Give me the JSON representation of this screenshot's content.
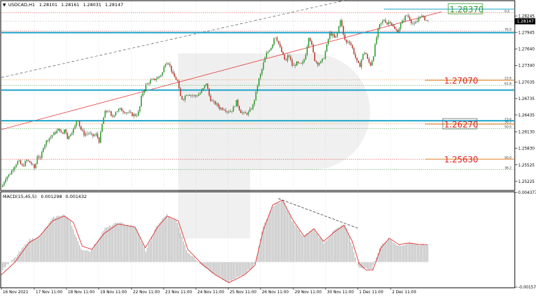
{
  "chart_data": [
    {
      "type": "candlestick",
      "header": {
        "symbol": "USDCAD,H1",
        "open": "1.28101",
        "high": "1.28161",
        "low": "1.28031",
        "close": "1.28147"
      },
      "current_price_label": "1.28147",
      "y_ticks": [
        "1.28245",
        "1.27945",
        "1.27640",
        "1.27340",
        "1.27035",
        "1.26735",
        "1.26435",
        "1.26130",
        "1.25830",
        "1.25525",
        "1.25225"
      ],
      "ylim": [
        1.2507,
        1.2851
      ],
      "x_ticks": [
        "16 Nov 2021",
        "17 Nov 11:00",
        "18 Nov 11:00",
        "19 Nov 11:00",
        "22 Nov 11:00",
        "23 Nov 11:00",
        "24 Nov 11:00",
        "25 Nov 11:00",
        "26 Nov 11:00",
        "29 Nov 11:00",
        "30 Nov 11:00",
        "1 Dec 11:00",
        "2 Dec 11:00"
      ],
      "horizontal_levels": [
        {
          "label": "1.28370",
          "value": 1.2837,
          "color": "#2e9e2e",
          "boxed": true
        },
        {
          "label": "1.27070",
          "value": 1.2707,
          "color": "#e02020",
          "boxed": false
        },
        {
          "label": "1.26270",
          "value": 1.2627,
          "color": "#e02020",
          "boxed": true
        },
        {
          "label": "1.25630",
          "value": 1.2563,
          "color": "#e02020",
          "boxed": false
        }
      ],
      "support_lines": [
        {
          "value": 1.2794,
          "color": "#17a2c8"
        },
        {
          "value": 1.2689,
          "color": "#17a2c8"
        },
        {
          "value": 1.2633,
          "color": "#17a2c8"
        }
      ],
      "fibo_upper": [
        {
          "label": "0.0",
          "value": 1.283,
          "color": "#e02020"
        },
        {
          "label": "76.0",
          "value": 1.2797,
          "color": "#e02020"
        },
        {
          "label": "23.6",
          "value": 1.2708,
          "color": "#e08020"
        },
        {
          "label": "61.8",
          "value": 1.2698,
          "color": "#2e9e2e"
        },
        {
          "label": "23.6",
          "value": 1.2633,
          "color": "#2e9e2e"
        },
        {
          "label": "38.2",
          "value": 1.2628,
          "color": "#e08020"
        },
        {
          "label": "50.0",
          "value": 1.2619,
          "color": "#2e9e2e"
        }
      ],
      "fibo_lower": [
        {
          "label": "50.0",
          "value": 1.2563,
          "color": "#e02020"
        },
        {
          "label": "38.2",
          "value": 1.2544,
          "color": "#2e9e2e"
        }
      ],
      "trend_lines": [
        {
          "from": [
            0,
            1.2712
          ],
          "to": [
            548,
            1.2866
          ],
          "color": "#555555",
          "dash": true
        },
        {
          "from": [
            0,
            1.2617
          ],
          "to": [
            642,
            1.2832
          ],
          "color": "#e02020",
          "dash": false
        }
      ],
      "close_path": [
        [
          0,
          1.2512
        ],
        [
          5,
          1.2528
        ],
        [
          12,
          1.2537
        ],
        [
          18,
          1.255
        ],
        [
          24,
          1.256
        ],
        [
          30,
          1.2549
        ],
        [
          36,
          1.2561
        ],
        [
          42,
          1.2556
        ],
        [
          48,
          1.2545
        ],
        [
          52,
          1.2572
        ],
        [
          56,
          1.2562
        ],
        [
          60,
          1.2585
        ],
        [
          66,
          1.2598
        ],
        [
          72,
          1.2605
        ],
        [
          78,
          1.2612
        ],
        [
          84,
          1.2618
        ],
        [
          88,
          1.2606
        ],
        [
          92,
          1.262
        ],
        [
          96,
          1.26
        ],
        [
          100,
          1.261
        ],
        [
          106,
          1.262
        ],
        [
          110,
          1.264
        ],
        [
          114,
          1.262
        ],
        [
          120,
          1.2608
        ],
        [
          126,
          1.2611
        ],
        [
          132,
          1.2605
        ],
        [
          138,
          1.2608
        ],
        [
          142,
          1.2595
        ],
        [
          146,
          1.2625
        ],
        [
          150,
          1.2648
        ],
        [
          156,
          1.2652
        ],
        [
          160,
          1.2638
        ],
        [
          166,
          1.265
        ],
        [
          172,
          1.2654
        ],
        [
          178,
          1.265
        ],
        [
          184,
          1.2648
        ],
        [
          190,
          1.2644
        ],
        [
          196,
          1.2643
        ],
        [
          200,
          1.265
        ],
        [
          204,
          1.268
        ],
        [
          210,
          1.2698
        ],
        [
          216,
          1.2705
        ],
        [
          222,
          1.2708
        ],
        [
          228,
          1.2712
        ],
        [
          234,
          1.272
        ],
        [
          238,
          1.2738
        ],
        [
          242,
          1.2742
        ],
        [
          246,
          1.273
        ],
        [
          250,
          1.2715
        ],
        [
          256,
          1.2706
        ],
        [
          260,
          1.2678
        ],
        [
          264,
          1.2672
        ],
        [
          270,
          1.2683
        ],
        [
          276,
          1.268
        ],
        [
          282,
          1.2678
        ],
        [
          288,
          1.2682
        ],
        [
          294,
          1.2692
        ],
        [
          298,
          1.2702
        ],
        [
          302,
          1.268
        ],
        [
          306,
          1.2668
        ],
        [
          312,
          1.2664
        ],
        [
          318,
          1.2656
        ],
        [
          324,
          1.2655
        ],
        [
          330,
          1.265
        ],
        [
          336,
          1.2652
        ],
        [
          342,
          1.2668
        ],
        [
          348,
          1.265
        ],
        [
          354,
          1.2645
        ],
        [
          360,
          1.2648
        ],
        [
          366,
          1.266
        ],
        [
          370,
          1.268
        ],
        [
          374,
          1.2705
        ],
        [
          378,
          1.272
        ],
        [
          382,
          1.274
        ],
        [
          386,
          1.2755
        ],
        [
          390,
          1.2763
        ],
        [
          394,
          1.277
        ],
        [
          398,
          1.279
        ],
        [
          402,
          1.278
        ],
        [
          406,
          1.2765
        ],
        [
          410,
          1.2752
        ],
        [
          414,
          1.274
        ],
        [
          418,
          1.2755
        ],
        [
          424,
          1.2732
        ],
        [
          430,
          1.2738
        ],
        [
          436,
          1.2735
        ],
        [
          440,
          1.274
        ],
        [
          444,
          1.276
        ],
        [
          448,
          1.279
        ],
        [
          452,
          1.277
        ],
        [
          456,
          1.2745
        ],
        [
          460,
          1.2738
        ],
        [
          466,
          1.274
        ],
        [
          470,
          1.275
        ],
        [
          474,
          1.277
        ],
        [
          478,
          1.2792
        ],
        [
          482,
          1.279
        ],
        [
          486,
          1.2782
        ],
        [
          490,
          1.2795
        ],
        [
          494,
          1.282
        ],
        [
          498,
          1.279
        ],
        [
          502,
          1.2775
        ],
        [
          506,
          1.278
        ],
        [
          510,
          1.277
        ],
        [
          514,
          1.2755
        ],
        [
          518,
          1.274
        ],
        [
          522,
          1.2732
        ],
        [
          526,
          1.2752
        ],
        [
          530,
          1.276
        ],
        [
          534,
          1.2742
        ],
        [
          538,
          1.2735
        ],
        [
          542,
          1.2752
        ],
        [
          546,
          1.2782
        ],
        [
          550,
          1.2805
        ],
        [
          554,
          1.2812
        ],
        [
          558,
          1.2818
        ],
        [
          562,
          1.281
        ],
        [
          566,
          1.2816
        ],
        [
          570,
          1.2806
        ],
        [
          574,
          1.2798
        ],
        [
          578,
          1.2797
        ],
        [
          582,
          1.281
        ],
        [
          586,
          1.2818
        ],
        [
          590,
          1.2826
        ],
        [
          594,
          1.2822
        ],
        [
          598,
          1.2812
        ],
        [
          602,
          1.2808
        ],
        [
          606,
          1.2815
        ],
        [
          610,
          1.2826
        ],
        [
          614,
          1.2822
        ],
        [
          618,
          1.2818
        ],
        [
          622,
          1.2815
        ]
      ],
      "macd": {
        "label": "MACD(15,45,5)",
        "values": [
          "0.001298",
          "0.001432"
        ],
        "y_ticks": [
          "0.004377",
          "-0.001577"
        ],
        "ylim": [
          -0.001577,
          0.004377
        ],
        "hist": [
          [
            0,
            -0.0005
          ],
          [
            20,
            0.0003
          ],
          [
            40,
            0.0014
          ],
          [
            55,
            0.0016
          ],
          [
            75,
            0.0028
          ],
          [
            90,
            0.003
          ],
          [
            100,
            0.0026
          ],
          [
            115,
            0.0008
          ],
          [
            130,
            0.0007
          ],
          [
            150,
            0.0021
          ],
          [
            170,
            0.0025
          ],
          [
            195,
            0.0022
          ],
          [
            210,
            0.0007
          ],
          [
            225,
            0.0022
          ],
          [
            240,
            0.003
          ],
          [
            255,
            0.0026
          ],
          [
            270,
            0.0007
          ],
          [
            290,
            -0.0001
          ],
          [
            310,
            -0.0008
          ],
          [
            330,
            -0.0013
          ],
          [
            355,
            -0.0007
          ],
          [
            370,
            -0.0001
          ],
          [
            380,
            0.0021
          ],
          [
            395,
            0.0035
          ],
          [
            410,
            0.0039
          ],
          [
            425,
            0.0025
          ],
          [
            440,
            0.0016
          ],
          [
            455,
            0.0021
          ],
          [
            470,
            0.0012
          ],
          [
            485,
            0.002
          ],
          [
            500,
            0.0024
          ],
          [
            510,
            0.0012
          ],
          [
            520,
            -0.0003
          ],
          [
            530,
            -0.0004
          ],
          [
            540,
            -0.0005
          ],
          [
            552,
            0.001
          ],
          [
            565,
            0.0015
          ],
          [
            580,
            0.001
          ],
          [
            595,
            0.0012
          ],
          [
            610,
            0.0011
          ],
          [
            622,
            0.0011
          ]
        ],
        "signal": [
          [
            0,
            -0.0008
          ],
          [
            20,
            0.0
          ],
          [
            40,
            0.0012
          ],
          [
            55,
            0.0016
          ],
          [
            75,
            0.0026
          ],
          [
            92,
            0.0029
          ],
          [
            105,
            0.0025
          ],
          [
            118,
            0.001
          ],
          [
            132,
            0.0008
          ],
          [
            150,
            0.0018
          ],
          [
            170,
            0.0024
          ],
          [
            195,
            0.0022
          ],
          [
            210,
            0.0009
          ],
          [
            228,
            0.0022
          ],
          [
            242,
            0.0029
          ],
          [
            258,
            0.0026
          ],
          [
            272,
            0.0008
          ],
          [
            292,
            -0.0001
          ],
          [
            312,
            -0.0008
          ],
          [
            332,
            -0.0013
          ],
          [
            355,
            -0.0008
          ],
          [
            370,
            -0.0002
          ],
          [
            382,
            0.002
          ],
          [
            396,
            0.0036
          ],
          [
            410,
            0.0039
          ],
          [
            426,
            0.0026
          ],
          [
            442,
            0.0016
          ],
          [
            456,
            0.0021
          ],
          [
            470,
            0.0013
          ],
          [
            486,
            0.0019
          ],
          [
            500,
            0.0023
          ],
          [
            512,
            0.0013
          ],
          [
            522,
            -0.0001
          ],
          [
            532,
            -0.0005
          ],
          [
            542,
            -0.0005
          ],
          [
            554,
            0.0009
          ],
          [
            566,
            0.0015
          ],
          [
            580,
            0.0011
          ],
          [
            595,
            0.0012
          ],
          [
            610,
            0.0011
          ],
          [
            622,
            0.0011
          ]
        ],
        "divergence_line": {
          "from": [
            404,
            0.004
          ],
          "to": [
            522,
            0.0021
          ]
        }
      }
    }
  ]
}
